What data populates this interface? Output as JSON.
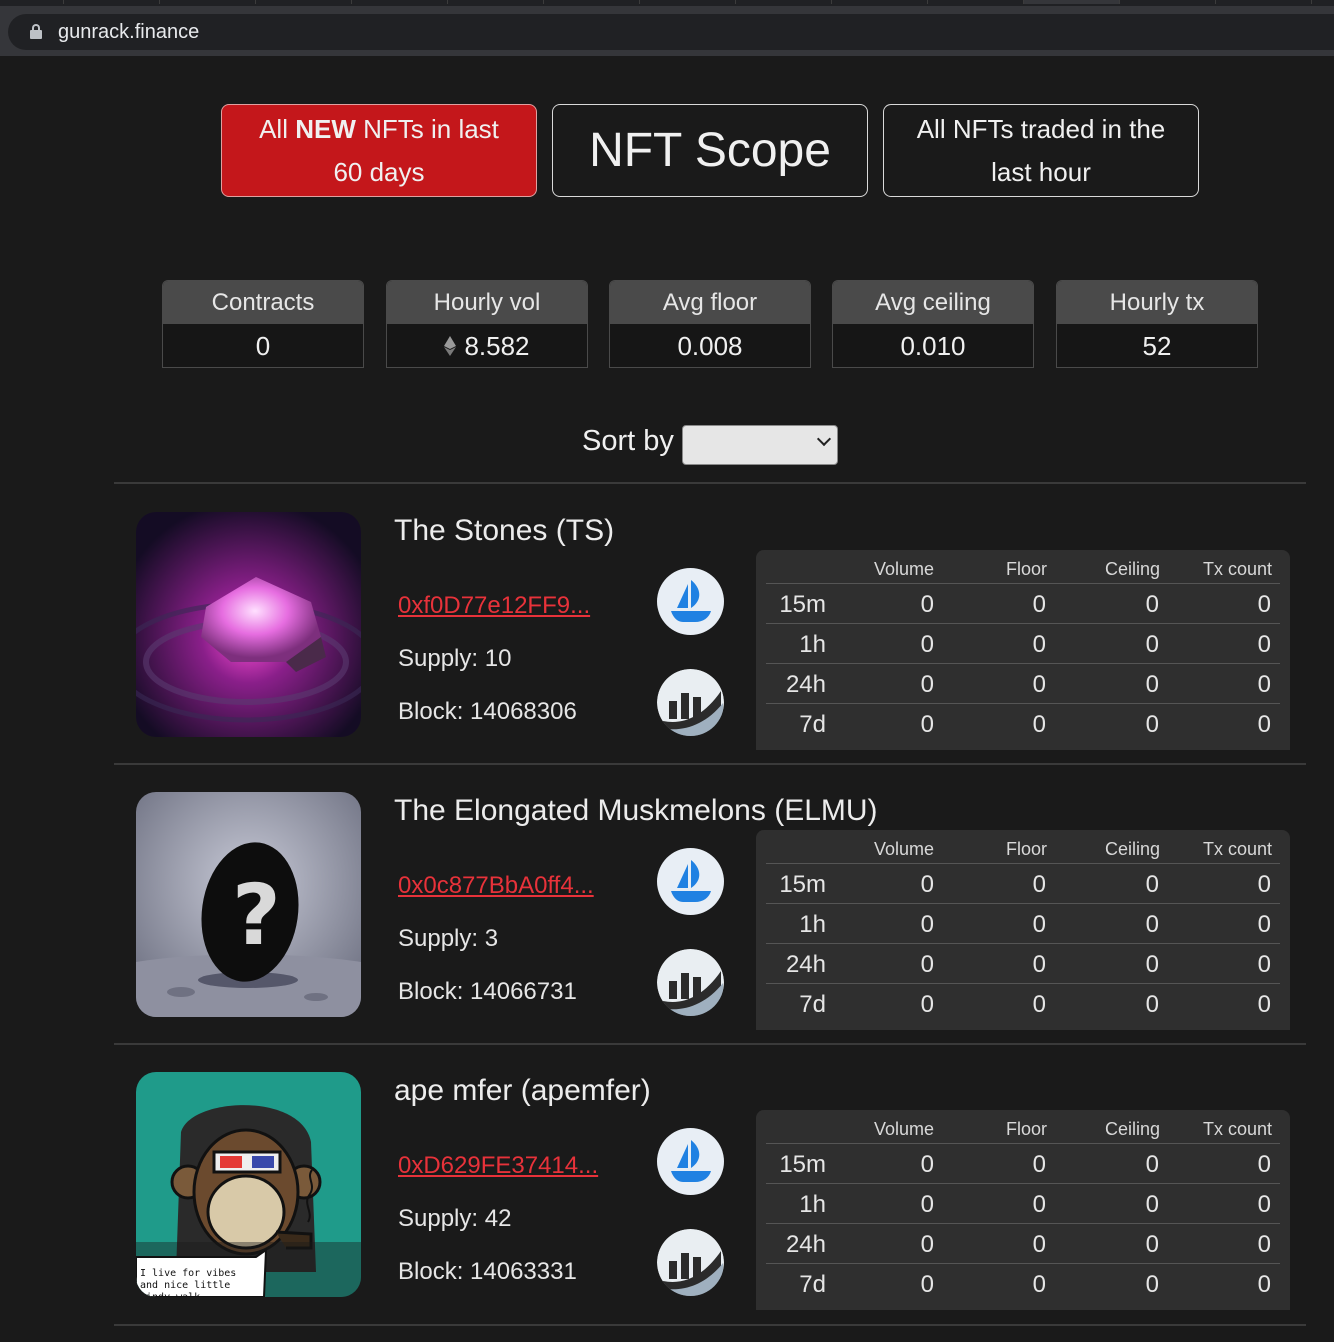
{
  "browser": {
    "url": "gunrack.finance"
  },
  "nav": {
    "new_pre": "All ",
    "new_bold": "NEW",
    "new_post": " NFTs in last 60 days",
    "scope": "NFT Scope",
    "traded": "All NFTs traded in the last hour"
  },
  "stats": [
    {
      "label": "Contracts",
      "value": "0"
    },
    {
      "label": "Hourly vol",
      "value": "8.582",
      "icon": "ethereum-icon"
    },
    {
      "label": "Avg floor",
      "value": "0.008"
    },
    {
      "label": "Avg ceiling",
      "value": "0.010"
    },
    {
      "label": "Hourly tx",
      "value": "52"
    }
  ],
  "sort": {
    "label": "Sort by",
    "selected": ""
  },
  "table_headers": [
    "Volume",
    "Floor",
    "Ceiling",
    "Tx count"
  ],
  "collections": [
    {
      "title": "The Stones (TS)",
      "address": "0xf0D77e12FF9...",
      "supply": "Supply: 10",
      "block": "Block: 14068306",
      "rows": [
        {
          "label": "15m",
          "values": [
            "0",
            "0",
            "0",
            "0"
          ]
        },
        {
          "label": "1h",
          "values": [
            "0",
            "0",
            "0",
            "0"
          ]
        },
        {
          "label": "24h",
          "values": [
            "0",
            "0",
            "0",
            "0"
          ]
        },
        {
          "label": "7d",
          "values": [
            "0",
            "0",
            "0",
            "0"
          ]
        }
      ]
    },
    {
      "title": "The Elongated Muskmelons (ELMU)",
      "address": "0x0c877BbA0ff4...",
      "supply": "Supply: 3",
      "block": "Block: 14066731",
      "rows": [
        {
          "label": "15m",
          "values": [
            "0",
            "0",
            "0",
            "0"
          ]
        },
        {
          "label": "1h",
          "values": [
            "0",
            "0",
            "0",
            "0"
          ]
        },
        {
          "label": "24h",
          "values": [
            "0",
            "0",
            "0",
            "0"
          ]
        },
        {
          "label": "7d",
          "values": [
            "0",
            "0",
            "0",
            "0"
          ]
        }
      ]
    },
    {
      "title": "ape mfer (apemfer)",
      "address": "0xD629FE37414...",
      "supply": "Supply: 42",
      "block": "Block: 14063331",
      "caption": "I live for vibes and nice little lindy walk",
      "rows": [
        {
          "label": "15m",
          "values": [
            "0",
            "0",
            "0",
            "0"
          ]
        },
        {
          "label": "1h",
          "values": [
            "0",
            "0",
            "0",
            "0"
          ]
        },
        {
          "label": "24h",
          "values": [
            "0",
            "0",
            "0",
            "0"
          ]
        },
        {
          "label": "7d",
          "values": [
            "0",
            "0",
            "0",
            "0"
          ]
        }
      ]
    }
  ],
  "colors": {
    "accent_red": "#c4171b",
    "link_red": "#e8323a",
    "background": "#1a1a1a"
  }
}
